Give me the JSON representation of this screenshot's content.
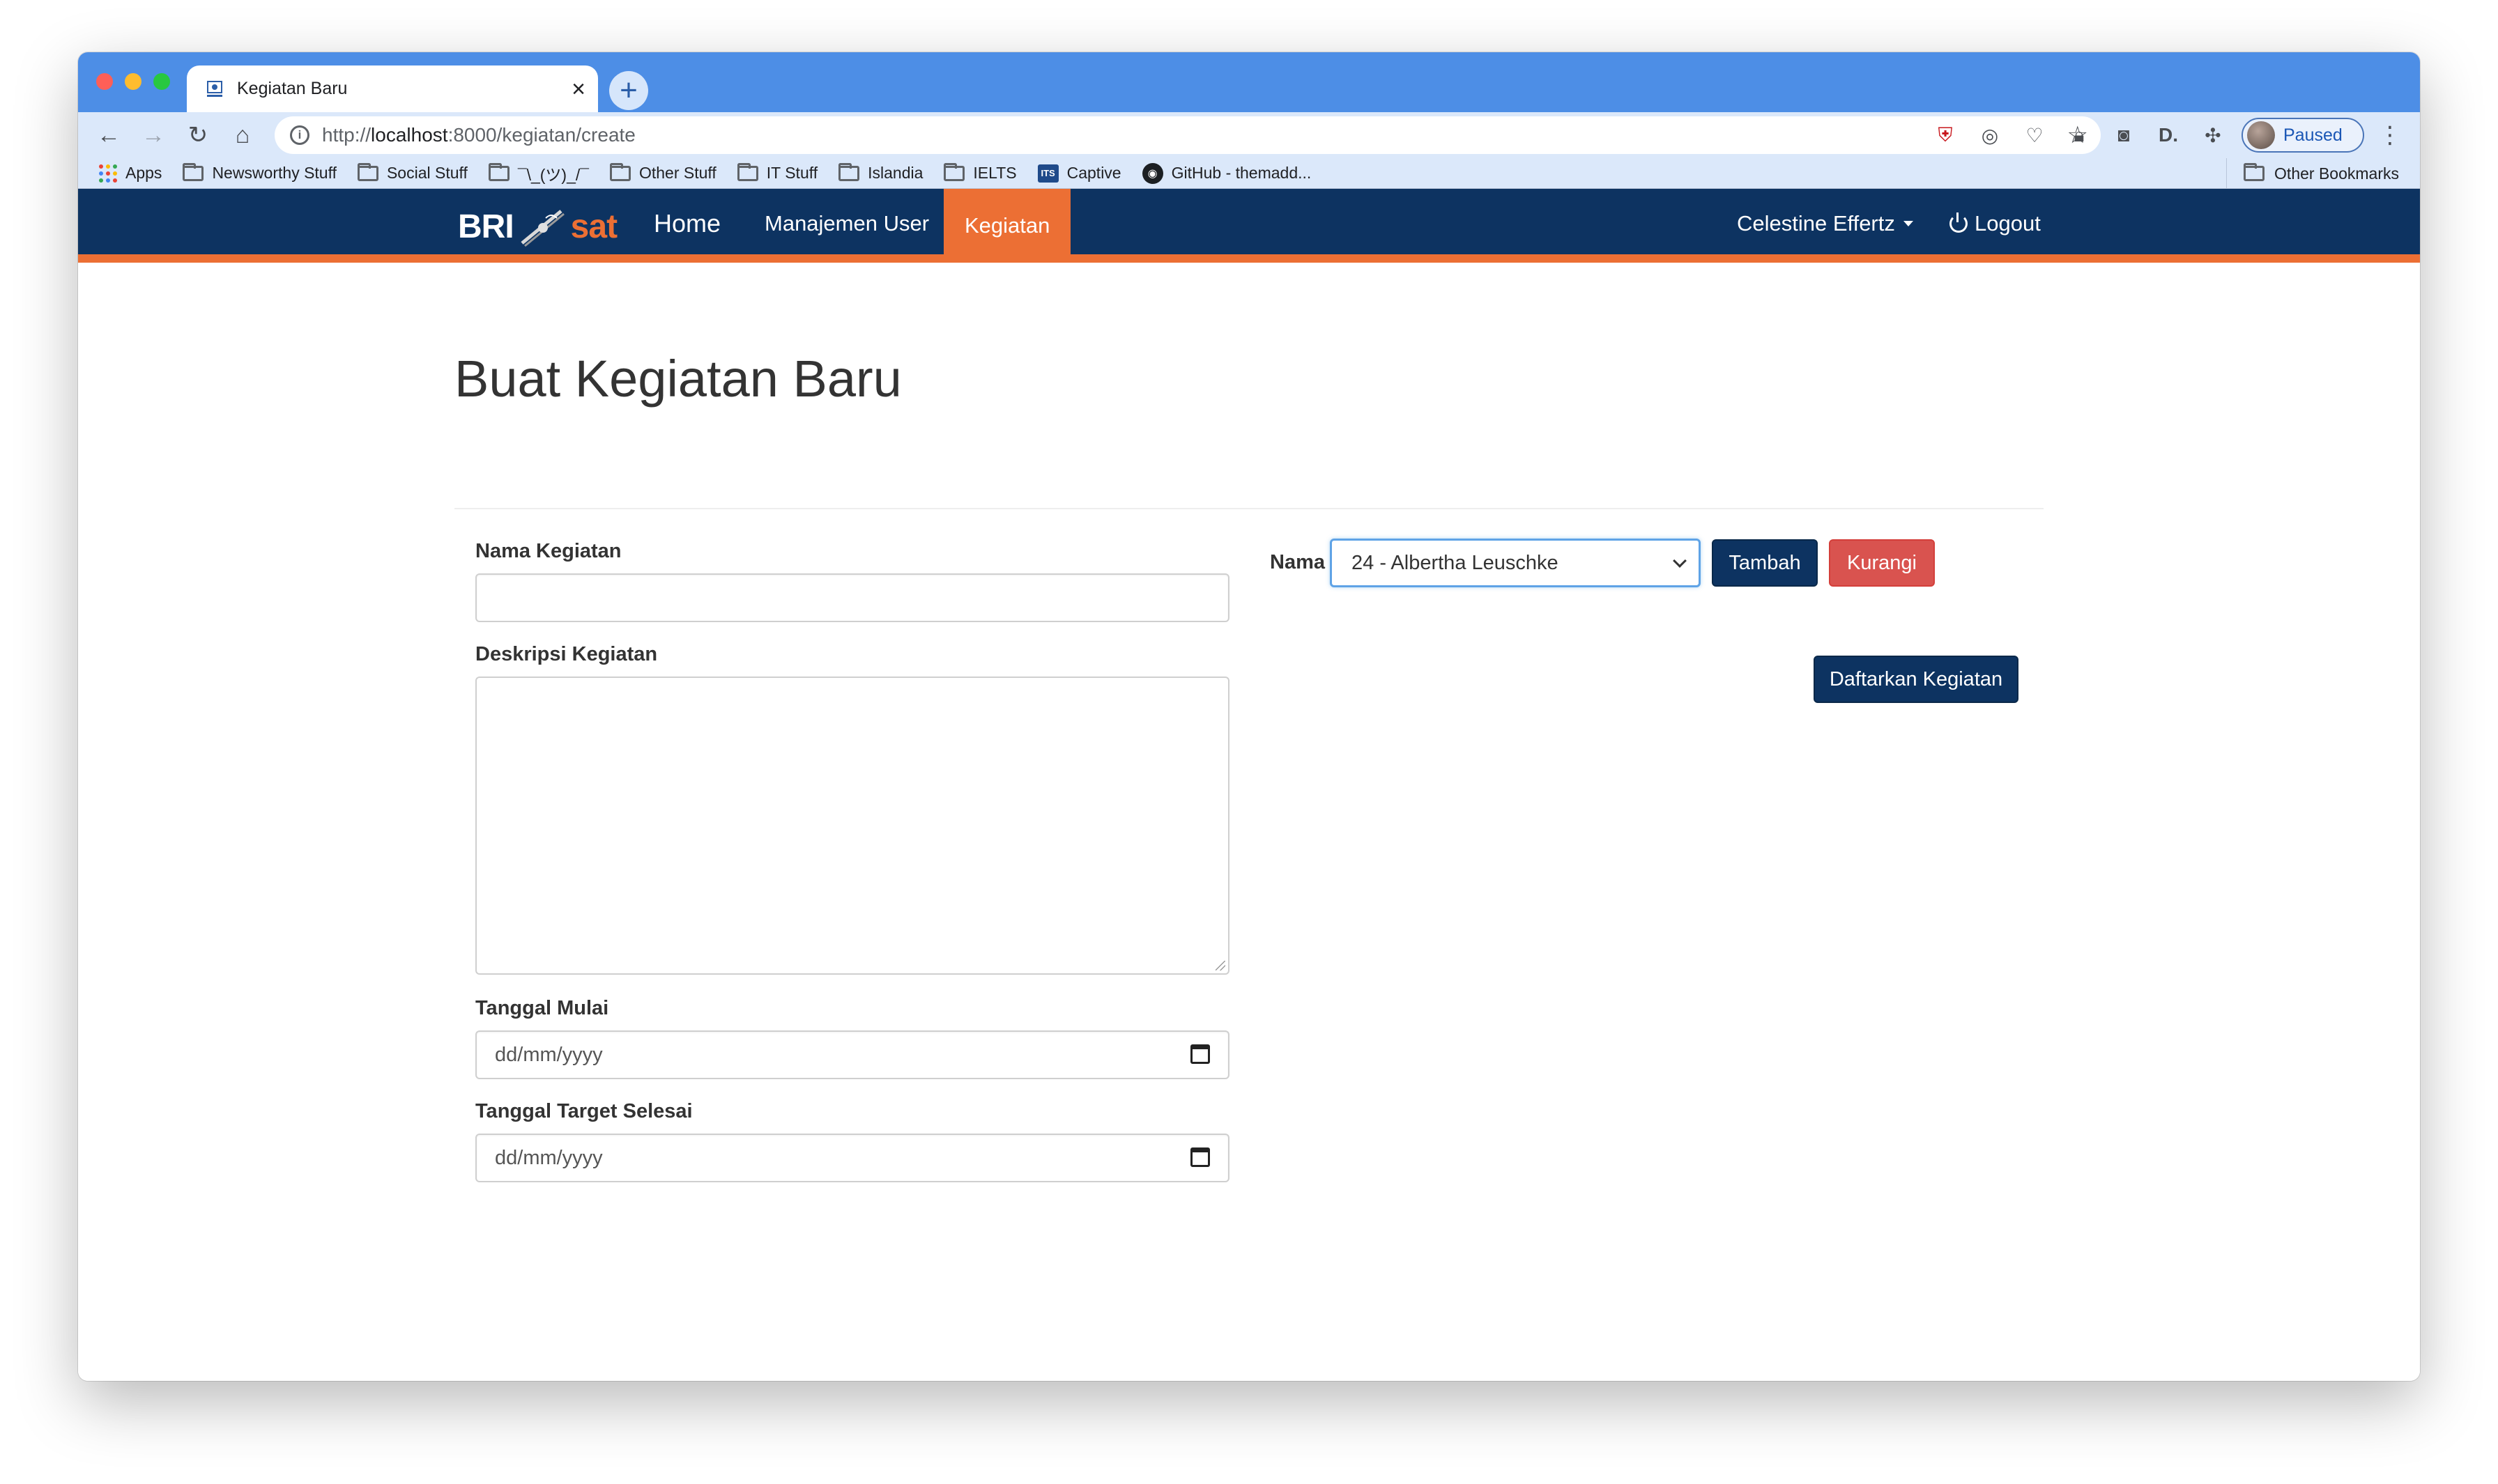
{
  "browser": {
    "tab_title": "Kegiatan Baru",
    "url_scheme": "http://",
    "url_host": "localhost",
    "url_rest": ":8000/kegiatan/create",
    "profile_label": "Paused",
    "bookmarks": [
      {
        "label": "Apps",
        "icon": "apps-icon"
      },
      {
        "label": "Newsworthy Stuff",
        "icon": "folder-icon"
      },
      {
        "label": "Social Stuff",
        "icon": "folder-icon"
      },
      {
        "label": "¯\\_(ツ)_/¯",
        "icon": "folder-icon"
      },
      {
        "label": "Other Stuff",
        "icon": "folder-icon"
      },
      {
        "label": "IT Stuff",
        "icon": "folder-icon"
      },
      {
        "label": "Islandia",
        "icon": "folder-icon"
      },
      {
        "label": "IELTS",
        "icon": "folder-icon"
      },
      {
        "label": "Captive",
        "icon": "its-icon"
      },
      {
        "label": "GitHub - themadd...",
        "icon": "github-icon"
      }
    ],
    "other_bookmarks": "Other Bookmarks"
  },
  "navbar": {
    "brand_left": "BRI",
    "brand_right": "sat",
    "links": [
      "Home",
      "Manajemen User",
      "Kegiatan"
    ],
    "active_link": "Kegiatan",
    "user_name": "Celestine Effertz",
    "logout_label": "Logout",
    "colors": {
      "navbar": "#0d3361",
      "accent": "#ec6f34"
    }
  },
  "form": {
    "title": "Buat Kegiatan Baru",
    "nama_kegiatan_label": "Nama Kegiatan",
    "nama_kegiatan_value": "",
    "deskripsi_label": "Deskripsi Kegiatan",
    "deskripsi_value": "",
    "tanggal_mulai_label": "Tanggal Mulai",
    "tanggal_mulai_placeholder": "dd/mm/yyyy",
    "tanggal_selesai_label": "Tanggal Target Selesai",
    "tanggal_selesai_placeholder": "dd/mm/yyyy",
    "nama_label": "Nama",
    "nama_selected": "24 - Albertha Leuschke",
    "tambah_label": "Tambah",
    "kurangi_label": "Kurangi",
    "submit_label": "Daftarkan Kegiatan"
  }
}
